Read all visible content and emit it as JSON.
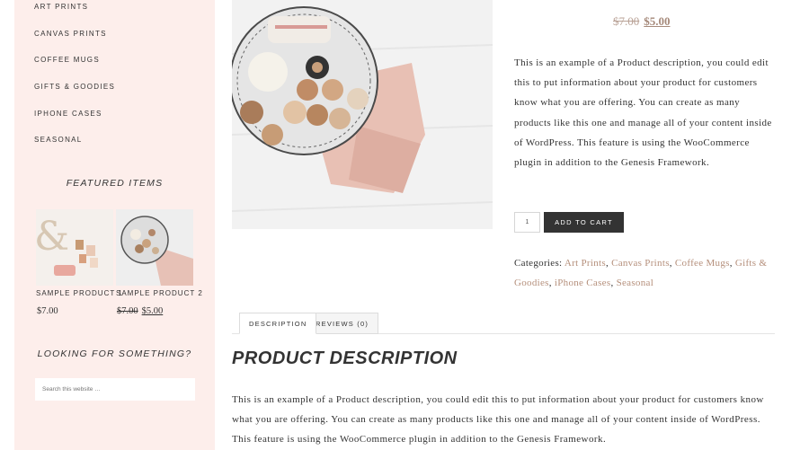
{
  "sidebar": {
    "categories": [
      "Art Prints",
      "Canvas Prints",
      "Coffee Mugs",
      "Gifts & Goodies",
      "iPhone Cases",
      "Seasonal"
    ],
    "featured_title": "Featured Items",
    "featured": [
      {
        "name": "Sample Product 1",
        "price": "$7.00"
      },
      {
        "name": "Sample Product 2",
        "old_price": "$7.00",
        "price": "$5.00"
      }
    ],
    "search_title": "Looking for Something?",
    "search_placeholder": "Search this website …"
  },
  "product": {
    "old_price": "$7.00",
    "price": "$5.00",
    "short_description": "This is an example of a Product description, you could edit this to put information about your product for customers know what you are offering. You can create as many products like this one and manage all of your content inside of WordPress. This feature is using the WooCommerce plugin in addition to the Genesis Framework.",
    "quantity": "1",
    "add_to_cart": "Add to cart",
    "categories_label": "Categories:",
    "categories": [
      "Art Prints",
      "Canvas Prints",
      "Coffee Mugs",
      "Gifts & Goodies",
      "iPhone Cases",
      "Seasonal"
    ]
  },
  "tabs": [
    {
      "label": "Description",
      "active": true
    },
    {
      "label": "Reviews (0)",
      "active": false
    }
  ],
  "description": {
    "heading": "Product Description",
    "body": "This is an example of a Product description, you could edit this to put information about your product for customers know what you are offering. You can create as many products like this one and manage all of your content inside of WordPress. This feature is using the WooCommerce plugin in addition to the Genesis Framework."
  },
  "colors": {
    "sidebar_bg": "#fdeeeb",
    "accent_link": "#b58f7b",
    "button_bg": "#333333"
  }
}
